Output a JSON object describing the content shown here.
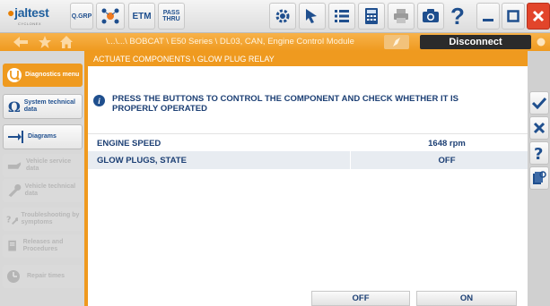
{
  "app": {
    "logo_text": "jaltest",
    "logo_sub": "CYCLONEX"
  },
  "toolbar": {
    "qgrp_label": "Q.GRP",
    "etm_label": "ETM",
    "pass_thru_label_1": "PASS",
    "pass_thru_label_2": "THRU",
    "help_label": "?"
  },
  "nav": {
    "path": "\\...\\...\\ BOBCAT \\ E50 Series \\ DL03, CAN, Engine Control Module",
    "disconnect_label": "Disconnect"
  },
  "sidebar": {
    "items": [
      {
        "label": "Diagnostics menu",
        "state": "active",
        "icon": "stethoscope-icon"
      },
      {
        "label": "System technical data",
        "state": "normal",
        "icon": "omega-icon"
      },
      {
        "label": "Diagrams",
        "state": "normal",
        "icon": "diagram-icon"
      },
      {
        "label": "Vehicle service data",
        "state": "disabled",
        "icon": "oil-can-icon"
      },
      {
        "label": "Vehicle technical data",
        "state": "disabled",
        "icon": "wrench-icon"
      },
      {
        "label": "Troubleshooting by symptoms",
        "state": "disabled",
        "icon": "question-wrench-icon"
      },
      {
        "label": "Releases and Procedures",
        "state": "disabled",
        "icon": "document-icon"
      },
      {
        "label": "Repair times",
        "state": "disabled",
        "icon": "clock-tools-icon"
      }
    ]
  },
  "main": {
    "header": "ACTUATE COMPONENTS \\ GLOW PLUG RELAY",
    "instruction": "PRESS THE BUTTONS TO CONTROL THE COMPONENT AND CHECK WHETHER IT IS PROPERLY OPERATED",
    "rows": [
      {
        "name": "ENGINE SPEED",
        "value": "1648 rpm"
      },
      {
        "name": "GLOW PLUGS, STATE",
        "value": "OFF"
      }
    ],
    "off_button": "OFF",
    "on_button": "ON"
  },
  "colors": {
    "accent_orange": "#ef9a1f",
    "text_blue": "#1c3f74",
    "close_red": "#e2452b",
    "confirm_blue": "#1f4f8e"
  }
}
